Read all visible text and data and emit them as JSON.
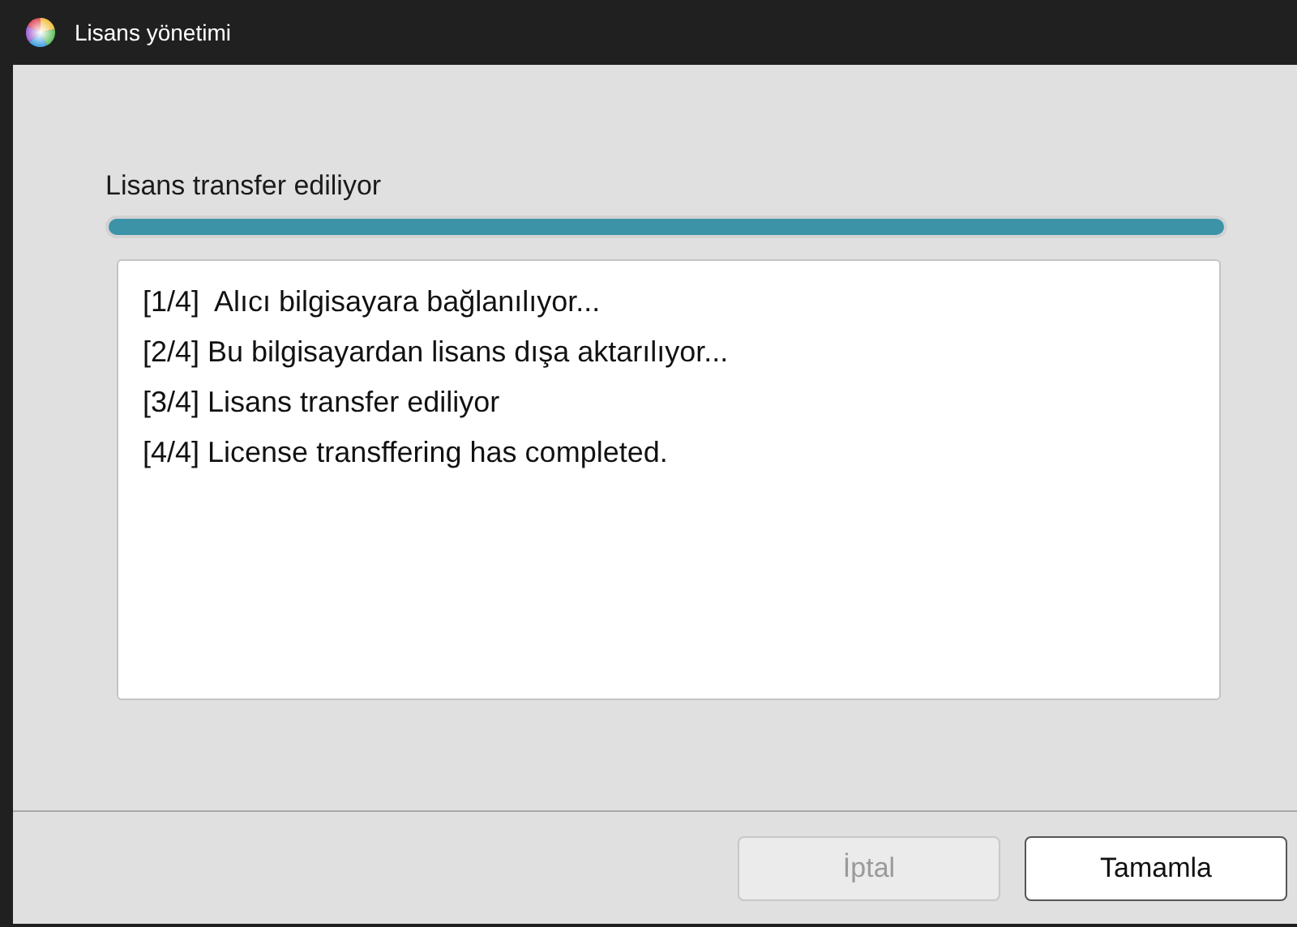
{
  "window": {
    "title": "Lisans yönetimi"
  },
  "progress": {
    "label": "Lisans transfer ediliyor",
    "level": 1
  },
  "log": [
    "[1/4]  Alıcı bilgisayara bağlanılıyor...",
    "[2/4] Bu bilgisayardan lisans dışa aktarılıyor...",
    "[3/4] Lisans transfer ediliyor",
    "[4/4] License transffering has completed."
  ],
  "buttons": [
    {
      "label": "İptal",
      "disabled": true
    },
    {
      "label": "Tamamla",
      "disabled": false
    }
  ]
}
